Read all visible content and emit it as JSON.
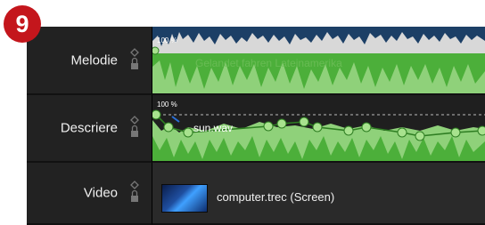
{
  "step_badge": "9",
  "tracks": [
    {
      "name": "Melodie",
      "volume": "100 %",
      "clip": "Gelandet fahren Lateinamerika"
    },
    {
      "name": "Descriere",
      "volume": "100 %",
      "clip": "sun.wav"
    },
    {
      "name": "Video",
      "clip": "computer.trec (Screen)"
    }
  ],
  "colors": {
    "audio_green": "#4caf3a",
    "audio_light": "#8fd17a",
    "melody_top": "#1c3f66",
    "header_bg": "#222222",
    "badge": "#c4161c"
  }
}
